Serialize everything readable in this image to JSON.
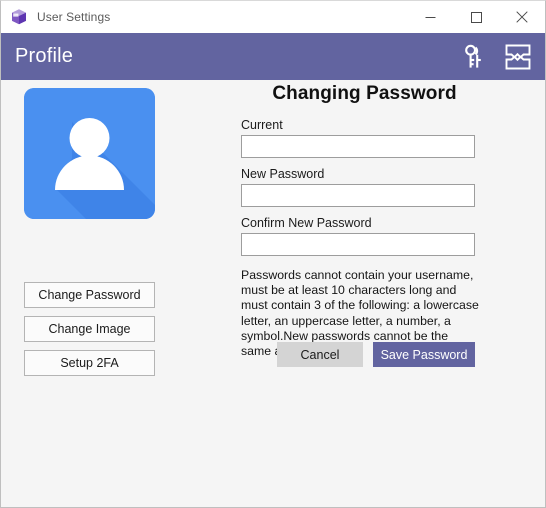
{
  "window": {
    "title": "User Settings",
    "app_icon": "app-box-icon",
    "controls": {
      "minimize": "minimize-icon",
      "maximize": "maximize-icon",
      "close": "close-icon"
    }
  },
  "header": {
    "title": "Profile",
    "accent_color": "#6264a0",
    "icons": [
      {
        "name": "keys-icon",
        "label": "Keys"
      },
      {
        "name": "torn-image-icon",
        "label": "Image"
      }
    ]
  },
  "profile": {
    "avatar": {
      "name": "user-avatar",
      "background_color": "#4a90f0",
      "shadow_color": "#3a7fe0",
      "glyph_color": "#ffffff"
    },
    "buttons": [
      {
        "name": "change-password-button",
        "label": "Change Password"
      },
      {
        "name": "change-image-button",
        "label": "Change Image"
      },
      {
        "name": "setup-2fa-button",
        "label": "Setup 2FA"
      }
    ]
  },
  "form": {
    "title": "Changing Password",
    "fields": [
      {
        "name": "current-password-field",
        "label": "Current",
        "value": "",
        "placeholder": ""
      },
      {
        "name": "new-password-field",
        "label": "New Password",
        "value": "",
        "placeholder": ""
      },
      {
        "name": "confirm-new-password-field",
        "label": "Confirm New Password",
        "value": "",
        "placeholder": ""
      }
    ],
    "hint": "Passwords cannot contain your username, must be at least 10 characters long and must contain 3 of the following: a lowercase letter, an uppercase letter, a number, a symbol.New passwords cannot be the same as the",
    "actions": {
      "cancel_label": "Cancel",
      "save_label": "Save Password",
      "save_color": "#6264a0",
      "cancel_color": "#d4d4d4"
    }
  }
}
